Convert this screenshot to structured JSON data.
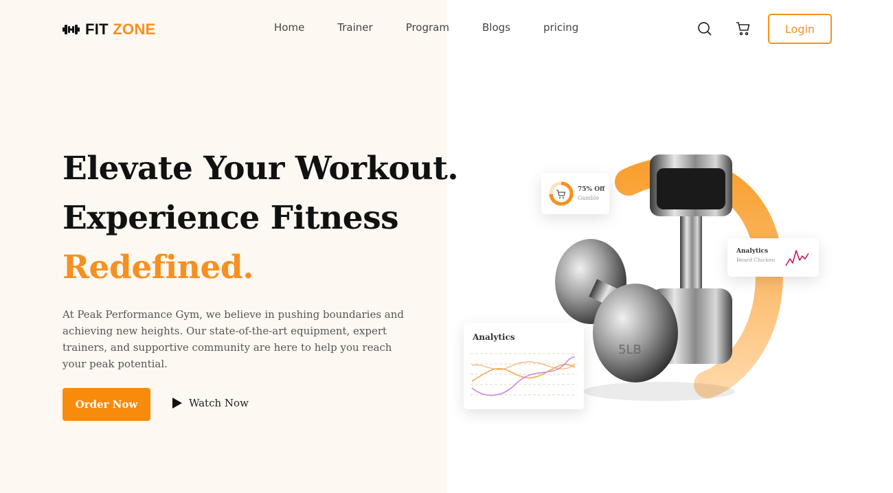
{
  "brand": {
    "name_part1": "FIT",
    "name_part2": "ZONE"
  },
  "nav": {
    "items": [
      "Home",
      "Trainer",
      "Program",
      "Blogs",
      "pricing"
    ]
  },
  "header": {
    "login_label": "Login"
  },
  "hero": {
    "line1": "Elevate Your Workout.",
    "line2": "Experience Fitness",
    "line3": "Redefined.",
    "description": "At Peak Performance Gym, we believe in pushing boundaries and achieving new heights. Our state-of-the-art equipment, expert trainers, and supportive community are here to help you reach your peak potential.",
    "order_label": "Order Now",
    "watch_label": "Watch Now"
  },
  "cards": {
    "discount_title": "75% Off",
    "discount_sub": "Gamble",
    "analytics_small_title": "Analytics",
    "analytics_small_sub": "Beard Chicken",
    "analytics_big_title": "Analytics"
  },
  "dumbbell_weight_label": "5LB",
  "colors": {
    "accent": "#f7901e",
    "button": "#f88b0b",
    "left_bg": "#fdf8f2"
  }
}
